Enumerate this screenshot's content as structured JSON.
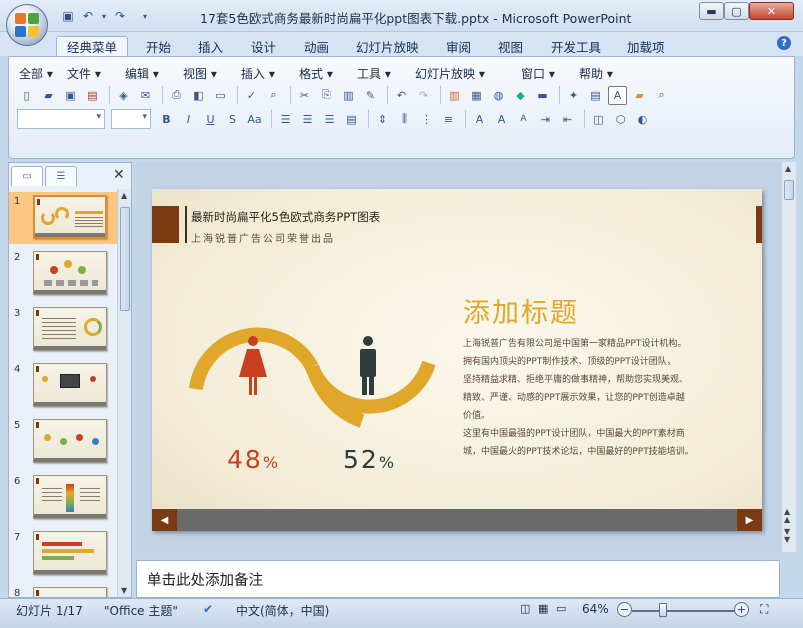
{
  "titlebar": {
    "document_title": "17套5色欧式商务最新时尚扁平化ppt图表下载.pptx - Microsoft PowerPoint",
    "qat_icons": [
      "save-icon",
      "undo-icon",
      "redo-icon",
      "customize-qat-icon"
    ],
    "window_buttons": [
      "minimize",
      "maximize",
      "close"
    ]
  },
  "ribbon_tabs": [
    {
      "label": "经典菜单",
      "active": true
    },
    {
      "label": "开始",
      "active": false
    },
    {
      "label": "插入",
      "active": false
    },
    {
      "label": "设计",
      "active": false
    },
    {
      "label": "动画",
      "active": false
    },
    {
      "label": "幻灯片放映",
      "active": false
    },
    {
      "label": "审阅",
      "active": false
    },
    {
      "label": "视图",
      "active": false
    },
    {
      "label": "开发工具",
      "active": false
    },
    {
      "label": "加载项",
      "active": false
    }
  ],
  "classic_menu": [
    "全部",
    "文件",
    "编辑",
    "视图",
    "插入",
    "格式",
    "工具",
    "幻灯片放映",
    "窗口",
    "帮助"
  ],
  "toolbar_row1_icons": [
    "new-icon",
    "open-icon",
    "save-icon",
    "pdf-icon",
    "permission-icon",
    "email-icon",
    "print-icon",
    "print-preview-icon",
    "spell-check-icon",
    "research-icon",
    "cut-icon",
    "copy-icon",
    "paste-icon",
    "format-painter-icon",
    "undo-icon",
    "redo-icon",
    "chart-icon",
    "table-icon",
    "clipart-icon",
    "color-icon",
    "image-icon",
    "textbox-icon",
    "slide-layout-icon",
    "shapes-icon",
    "find-icon"
  ],
  "toolbar_row2_icons": [
    "bold-icon",
    "italic-icon",
    "underline-icon",
    "strikethrough-icon",
    "font-size-icon",
    "align-left-icon",
    "align-center-icon",
    "align-right-icon",
    "justify-icon",
    "spacing-icon",
    "columns-icon",
    "bullets-icon",
    "numbering-icon",
    "font-color-icon",
    "grow-font-icon",
    "shrink-font-icon",
    "indent-icon",
    "outdent-icon",
    "arrange-icon",
    "group-icon",
    "shape-fill-icon"
  ],
  "toolbar_row2_text": {
    "bold": "B",
    "italic": "I",
    "underline": "U",
    "strike": "S",
    "case": "Aa",
    "font_color": "A",
    "grow": "A",
    "shrink": "A"
  },
  "slides_pane": {
    "tab_outline": "outline-tab",
    "tab_slides": "slides-tab",
    "slides": [
      {
        "number": "1",
        "selected": true
      },
      {
        "number": "2",
        "selected": false
      },
      {
        "number": "3",
        "selected": false
      },
      {
        "number": "4",
        "selected": false
      },
      {
        "number": "5",
        "selected": false
      },
      {
        "number": "6",
        "selected": false
      },
      {
        "number": "7",
        "selected": false
      },
      {
        "number": "8",
        "selected": false
      }
    ]
  },
  "slide": {
    "header_title": "最新时尚扁平化5色欧式商务PPT图表",
    "header_subtitle": "上海锐普广告公司荣誉出品",
    "left_percent": "48",
    "right_percent": "52",
    "percent_sign": "%",
    "content_title": "添加标题",
    "content_body": [
      "上海锐普广告有限公司是中国第一家精品PPT设计机构。",
      "拥有国内顶尖的PPT制作技术、顶级的PPT设计团队，",
      "坚持精益求精、拒绝平庸的做事精神，帮助您实现美观、",
      "精致、严谨、动感的PPT展示效果，让您的PPT创造卓越",
      "价值。",
      "这里有中国最强的PPT设计团队，中国最大的PPT素材商",
      "城，中国最火的PPT技术论坛，中国最好的PPT技能培训。"
    ],
    "colors": {
      "accent": "#e1a72b",
      "brown": "#7b3a12",
      "female": "#c9401f",
      "male": "#2e3d3d",
      "wave": "#e1a72b"
    }
  },
  "notes": {
    "placeholder": "单击此处添加备注"
  },
  "status": {
    "slide_info": "幻灯片 1/17",
    "theme": "\"Office 主题\"",
    "language": "中文(简体，中国)",
    "zoom": "64%",
    "zoom_level": 0.64
  }
}
